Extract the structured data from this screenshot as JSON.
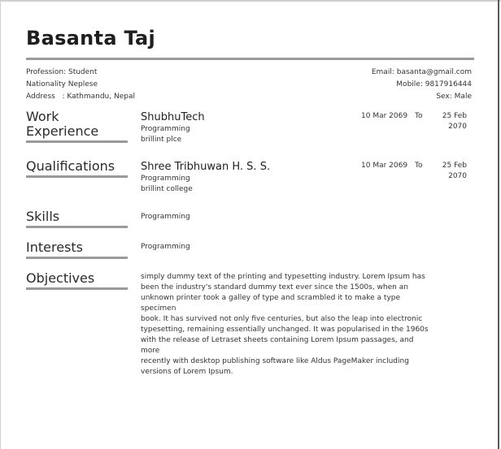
{
  "name": "Basanta Taj",
  "personal": {
    "profession_label": "Profession:",
    "profession": "Student",
    "nationality_label": "Nationality",
    "nationality": "Neplese",
    "address_label": "Address",
    "address_sep": ":",
    "address": "Kathmandu, Nepal",
    "email_label": "Email:",
    "email": "basanta@gmail.com",
    "mobile_label": "Mobile:",
    "mobile": "9817916444",
    "sex_label": "Sex:",
    "sex": "Male"
  },
  "work": {
    "title_line1": "Work",
    "title_line2": "Experience",
    "org": "ShubhuTech",
    "role": "Programming",
    "note": "brillint plce",
    "from": "10 Mar 2069",
    "to_label": "To",
    "end_day": "25 Feb",
    "end_year": "2070"
  },
  "qualifications": {
    "title": "Qualifications",
    "org": "Shree Tribhuwan H. S. S.",
    "field": "Programming",
    "note": "brillint college",
    "from": "10 Mar 2069",
    "to_label": "To",
    "end_day": "25 Feb",
    "end_year": "2070"
  },
  "skills": {
    "title": "Skills",
    "value": "Programming"
  },
  "interests": {
    "title": "Interests",
    "value": "Programming"
  },
  "objectives": {
    "title": "Objectives",
    "lines": [
      "simply dummy text of the printing and typesetting industry. Lorem Ipsum has",
      "been the industry's standard dummy text ever since the 1500s, when an",
      "unknown printer took a galley of type and scrambled it to make a type specimen",
      "book. It has survived not only five centuries, but also the leap into electronic",
      "typesetting, remaining essentially unchanged. It was popularised in the 1960s",
      "with the release of Letraset sheets containing Lorem Ipsum passages, and more",
      "recently with desktop publishing software like Aldus PageMaker including",
      "versions of Lorem Ipsum."
    ]
  }
}
